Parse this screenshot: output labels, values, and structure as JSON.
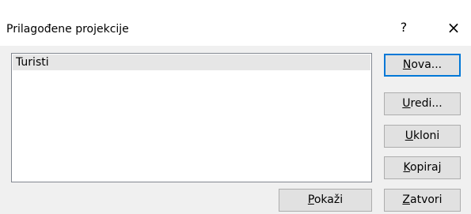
{
  "dialog": {
    "title": "Prilagođene projekcije",
    "help_label": "?",
    "close_label": "×"
  },
  "list": {
    "items": [
      "Turisti"
    ],
    "selected_index": 0
  },
  "buttons": {
    "new": {
      "mnemonic": "N",
      "rest": "ova..."
    },
    "edit": {
      "mnemonic": "U",
      "rest": "redi..."
    },
    "delete": {
      "mnemonic": "U",
      "rest": "kloni"
    },
    "copy": {
      "mnemonic": "K",
      "rest": "opiraj"
    },
    "show": {
      "mnemonic": "P",
      "rest": "okaži"
    },
    "close": {
      "mnemonic": "Z",
      "rest": "atvori"
    }
  }
}
